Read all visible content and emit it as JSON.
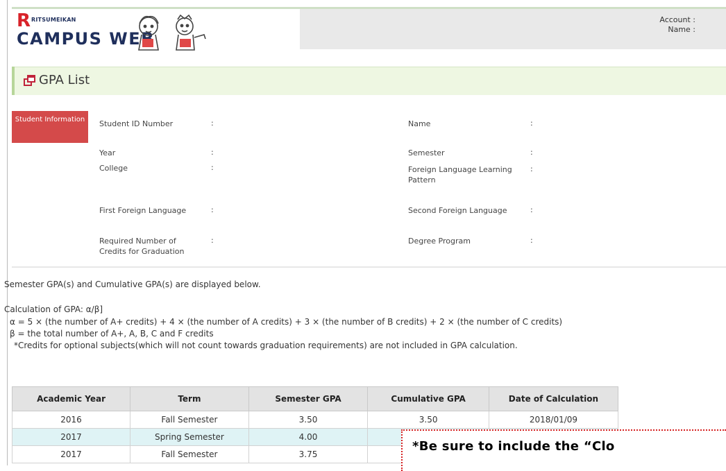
{
  "header": {
    "logo_r": "R",
    "logo_small": "RITSUMEIKAN",
    "logo_big": "CAMPUS WEB",
    "account_label": "Account :",
    "name_label": "Name :"
  },
  "page": {
    "title": "GPA List"
  },
  "student_info": {
    "badge": "Student Information",
    "left_fields": [
      {
        "label": "Student ID Number",
        "colon": ":"
      },
      {
        "label": "Year",
        "colon": ":"
      },
      {
        "label": "College",
        "colon": ":"
      },
      {
        "label": "First Foreign Language",
        "colon": ":"
      },
      {
        "label": "Required Number of Credits for Graduation",
        "colon": ":"
      }
    ],
    "right_fields": [
      {
        "label": "Name",
        "colon": ":"
      },
      {
        "label": "Semester",
        "colon": ":"
      },
      {
        "label": "Foreign Language Learning Pattern",
        "colon": ":"
      },
      {
        "label": "Second Foreign Language",
        "colon": ":"
      },
      {
        "label": "Degree Program",
        "colon": ":"
      }
    ]
  },
  "text": {
    "intro": "Semester GPA(s) and Cumulative GPA(s) are displayed below.",
    "calc_title": "Calculation of GPA: α/β]",
    "alpha_line": "α = 5 × (the number of A+ credits) + 4 × (the number of A credits) + 3 × (the number of B credits) + 2 × (the number of C credits)",
    "beta_line": "β = the total number of A+, A, B, C and F credits",
    "note_line": "*Credits for optional subjects(which will not count towards graduation requirements) are not included in GPA calculation."
  },
  "table": {
    "headers": [
      "Academic Year",
      "Term",
      "Semester GPA",
      "Cumulative GPA",
      "Date of Calculation"
    ],
    "rows": [
      [
        "2016",
        "Fall Semester",
        "3.50",
        "3.50",
        "2018/01/09"
      ],
      [
        "2017",
        "Spring Semester",
        "4.00",
        "",
        ""
      ],
      [
        "2017",
        "Fall Semester",
        "3.75",
        "",
        ""
      ]
    ]
  },
  "overlay": {
    "note": "*Be sure to include the “Clo"
  },
  "colors": {
    "brand_red": "#d8232a",
    "brand_navy": "#1f2f5c",
    "badge_red": "#d44a4a",
    "title_bg": "#eef7e2"
  }
}
